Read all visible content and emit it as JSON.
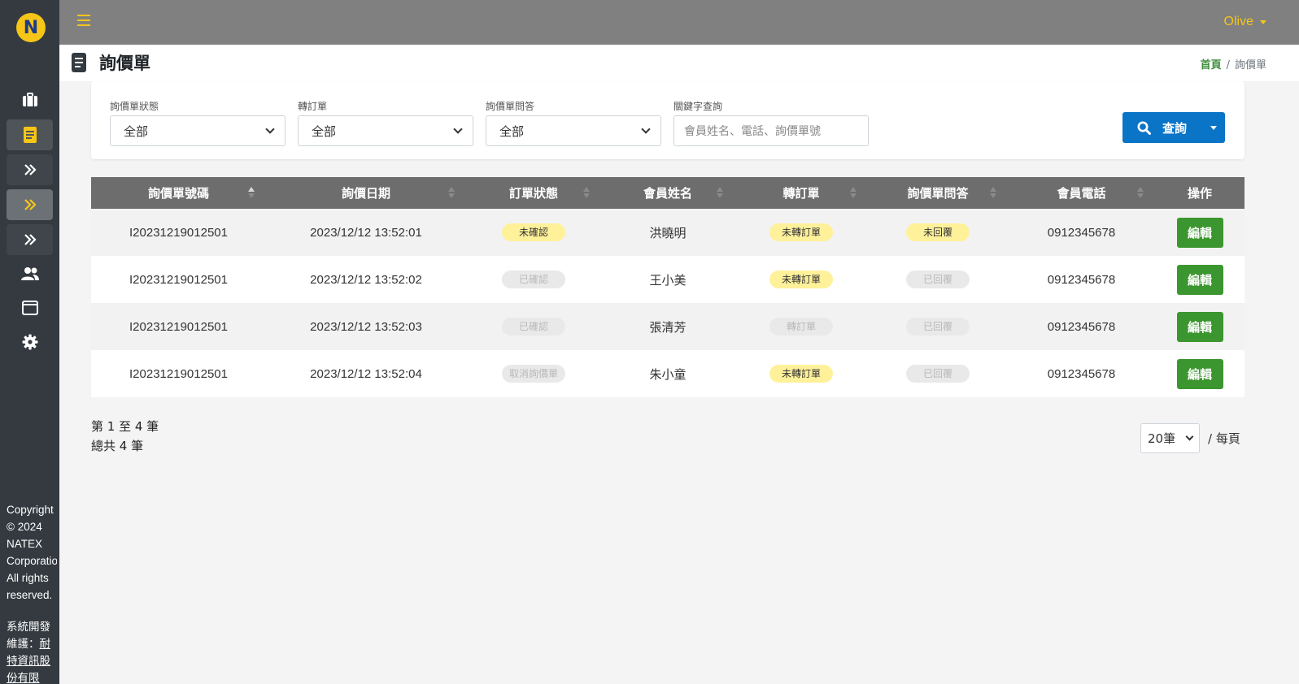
{
  "topbar": {
    "user": "Olive"
  },
  "page": {
    "title": "詢價單"
  },
  "breadcrumb": {
    "home": "首頁",
    "sep": "/",
    "current": "詢價單"
  },
  "filters": {
    "status": {
      "label": "詢價單狀態",
      "value": "全部"
    },
    "convert": {
      "label": "轉訂單",
      "value": "全部"
    },
    "qa": {
      "label": "詢價單問答",
      "value": "全部"
    },
    "keyword": {
      "label": "關鍵字查詢",
      "placeholder": "會員姓名、電話、詢價單號"
    },
    "search_label": "查詢"
  },
  "table": {
    "headers": [
      "詢價單號碼",
      "詢價日期",
      "訂單狀態",
      "會員姓名",
      "轉訂單",
      "詢價單問答",
      "會員電話",
      "操作"
    ],
    "rows": [
      {
        "id": "I20231219012501",
        "date": "2023/12/12 13:52:01",
        "status": "未確認",
        "name": "洪曉明",
        "convert": "未轉訂單",
        "qa": "未回覆",
        "phone": "0912345678",
        "action": "編輯"
      },
      {
        "id": "I20231219012501",
        "date": "2023/12/12 13:52:02",
        "status": "已確認",
        "name": "王小美",
        "convert": "未轉訂單",
        "qa": "已回覆",
        "phone": "0912345678",
        "action": "編輯"
      },
      {
        "id": "I20231219012501",
        "date": "2023/12/12 13:52:03",
        "status": "已確認",
        "name": "張清芳",
        "convert": "轉訂單",
        "qa": "已回覆",
        "phone": "0912345678",
        "action": "編輯"
      },
      {
        "id": "I20231219012501",
        "date": "2023/12/12 13:52:04",
        "status": "取消詢價單",
        "name": "朱小童",
        "convert": "未轉訂單",
        "qa": "已回覆",
        "phone": "0912345678",
        "action": "編輯"
      }
    ]
  },
  "summary": {
    "range": "第 1 至 4 筆",
    "total": "總共 4 筆"
  },
  "page_size": {
    "value": "20筆",
    "suffix": "/ 每頁"
  },
  "sidebar": {
    "logo_letter": "N",
    "footer": {
      "copyright": [
        "Copyright",
        "© 2024",
        "NATEX",
        "Corporation",
        "All rights",
        "reserved."
      ],
      "dev_label": "系統開發維護：",
      "dev_link": "耐特資訊股份有限"
    }
  },
  "colors": {
    "accent": "#f5c518",
    "primary": "#0a74c7",
    "success": "#3c962f",
    "sidebar": "#343a40",
    "topbar": "#808080",
    "badge_yellow": "#fff19a",
    "badge_grey": "#e9e9e9"
  }
}
